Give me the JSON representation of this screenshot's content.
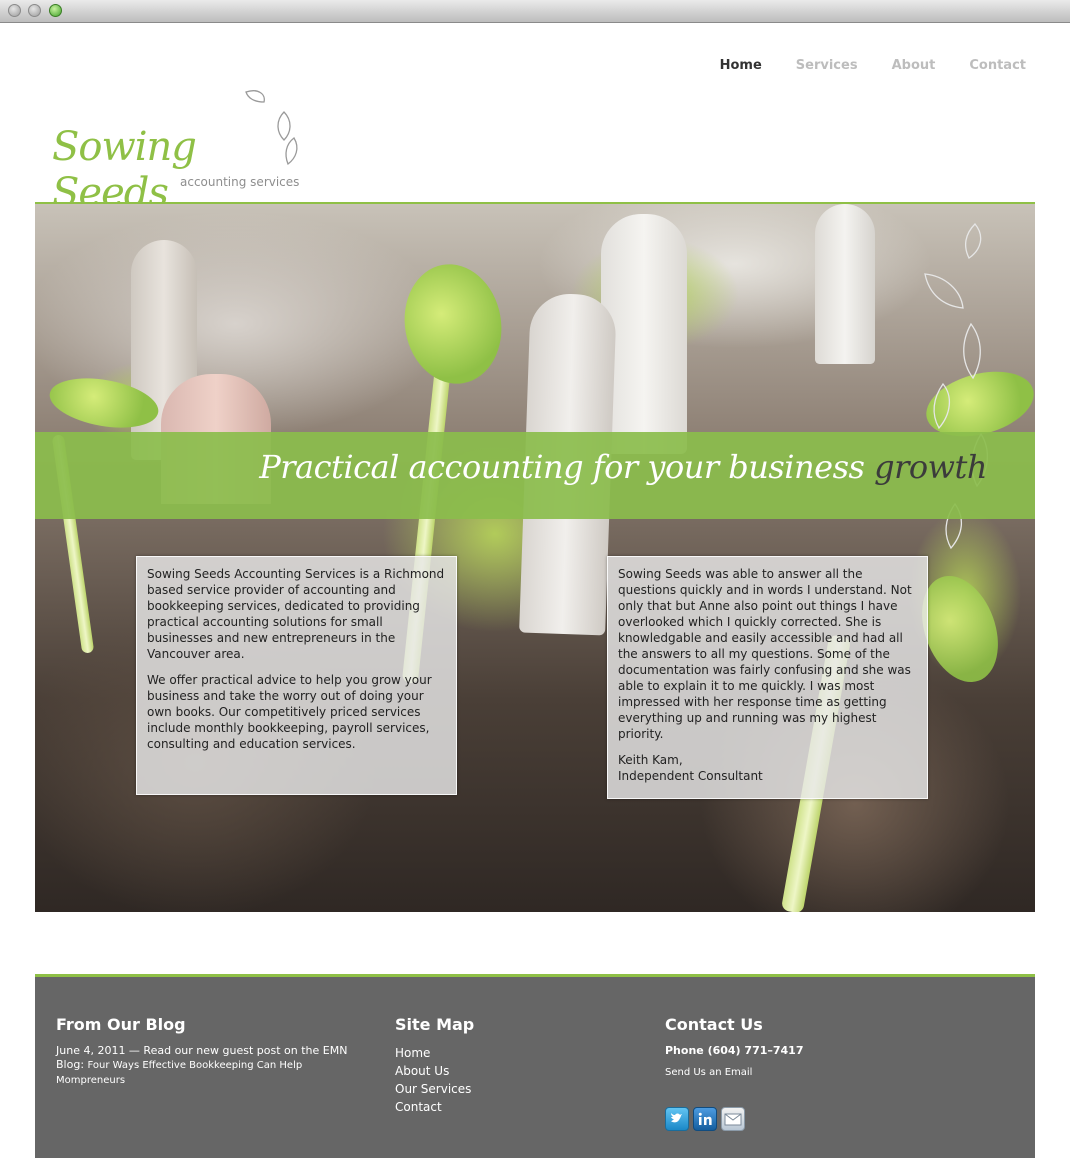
{
  "nav": {
    "items": [
      {
        "label": "Home",
        "active": true
      },
      {
        "label": "Services",
        "active": false
      },
      {
        "label": "About",
        "active": false
      },
      {
        "label": "Contact",
        "active": false
      }
    ]
  },
  "logo": {
    "word": "Sowing Seeds",
    "sub": "accounting services"
  },
  "hero": {
    "tagline_main": "Practical accounting for your business",
    "tagline_accent": "growth"
  },
  "intro": {
    "p1": "Sowing Seeds Accounting Services is a Richmond based service provider of accounting and bookkeeping services, dedicated to providing practical accounting solutions for small businesses and new entrepreneurs in the Vancouver area.",
    "p2": "We offer practical advice to help you grow your business and take the worry out of doing your own books. Our competitively priced services include monthly bookkeeping, payroll services, consulting and education services."
  },
  "testimonial": {
    "quote": "Sowing Seeds was able to answer all the questions quickly and in words I understand. Not only that but Anne also point out things I have overlooked which I quickly corrected. She is knowledgable and easily accessible and had all the answers to all my questions. Some of the documentation was fairly confusing and she was able to explain it to me quickly. I was most impressed with her response time as getting everything up and running was my highest priority.",
    "author": "Keith Kam,",
    "role": "Independent Consultant"
  },
  "footer": {
    "blog": {
      "heading": "From Our Blog",
      "text": "June 4, 2011 — Read our new guest post on the EMN Blog:",
      "link": "Four Ways Effective Bookkeeping Can Help Mompreneurs"
    },
    "sitemap": {
      "heading": "Site Map",
      "links": [
        "Home",
        "About Us",
        "Our Services",
        "Contact"
      ]
    },
    "contact": {
      "heading": "Contact Us",
      "phone": "Phone (604) 771–7417",
      "email_link": "Send Us an Email",
      "socials": [
        "twitter-icon",
        "linkedin-icon",
        "email-icon"
      ]
    }
  },
  "colors": {
    "brand_green": "#8fc046",
    "footer_gray": "#666666",
    "nav_active": "#333333",
    "nav_inactive": "#bdbdbd"
  }
}
